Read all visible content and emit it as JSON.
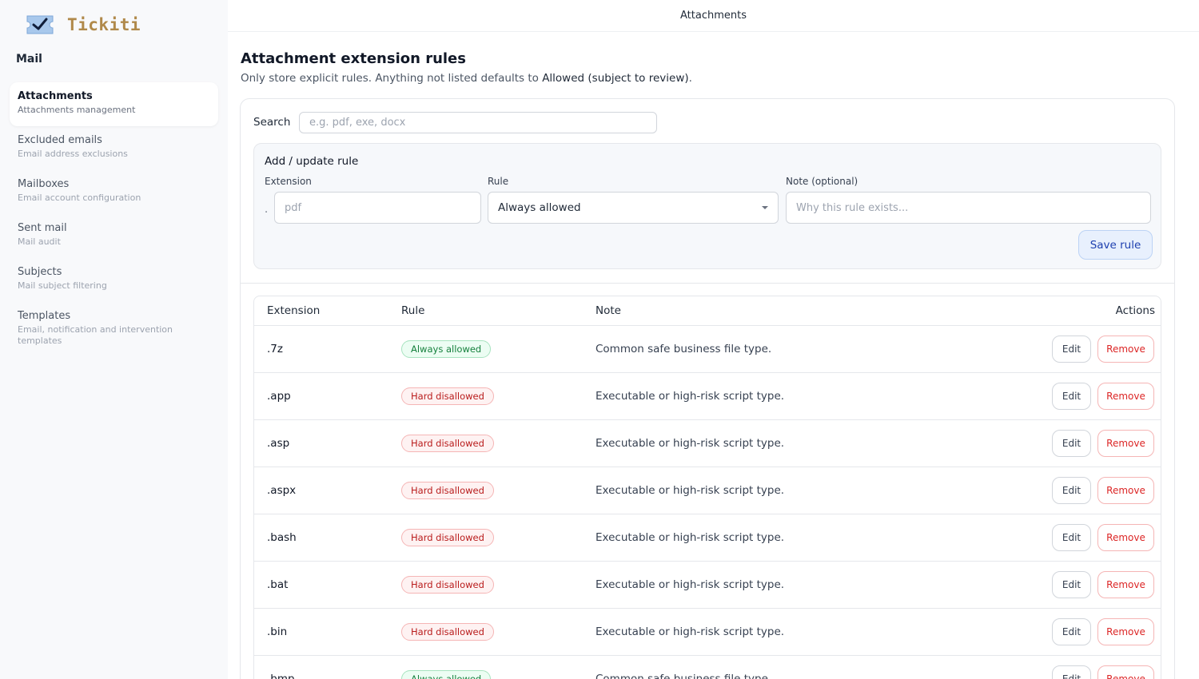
{
  "brand": {
    "name": "Tickiti",
    "logo_icon": "ticket-check-icon",
    "colors": {
      "brand_text": "#b0894a",
      "ticket_fill": "#a8c8ec",
      "check": "#0f1d3a"
    }
  },
  "sidebar": {
    "section": "Mail",
    "items": [
      {
        "label": "Attachments",
        "sub": "Attachments management",
        "active": true
      },
      {
        "label": "Excluded emails",
        "sub": "Email address exclusions"
      },
      {
        "label": "Mailboxes",
        "sub": "Email account configuration"
      },
      {
        "label": "Sent mail",
        "sub": "Mail audit"
      },
      {
        "label": "Subjects",
        "sub": "Mail subject filtering"
      },
      {
        "label": "Templates",
        "sub": "Email, notification and intervention templates"
      }
    ]
  },
  "header": {
    "title": "Attachments"
  },
  "main": {
    "title": "Attachment extension rules",
    "subtitle_prefix": "Only store explicit rules. Anything not listed defaults to ",
    "subtitle_bold": "Allowed (subject to review)",
    "subtitle_suffix": "."
  },
  "search": {
    "label": "Search",
    "placeholder": "e.g. pdf, exe, docx",
    "value": ""
  },
  "form": {
    "title": "Add / update rule",
    "extension_label": "Extension",
    "extension_prefix": ".",
    "extension_placeholder": "pdf",
    "rule_label": "Rule",
    "rule_value": "Always allowed",
    "note_label": "Note (optional)",
    "note_placeholder": "Why this rule exists...",
    "save_label": "Save rule"
  },
  "table": {
    "headers": {
      "extension": "Extension",
      "rule": "Rule",
      "note": "Note",
      "actions": "Actions"
    },
    "edit_label": "Edit",
    "remove_label": "Remove",
    "rows": [
      {
        "ext": ".7z",
        "rule": "Always allowed",
        "kind": "allowed",
        "note": "Common safe business file type."
      },
      {
        "ext": ".app",
        "rule": "Hard disallowed",
        "kind": "disallowed",
        "note": "Executable or high-risk script type."
      },
      {
        "ext": ".asp",
        "rule": "Hard disallowed",
        "kind": "disallowed",
        "note": "Executable or high-risk script type."
      },
      {
        "ext": ".aspx",
        "rule": "Hard disallowed",
        "kind": "disallowed",
        "note": "Executable or high-risk script type."
      },
      {
        "ext": ".bash",
        "rule": "Hard disallowed",
        "kind": "disallowed",
        "note": "Executable or high-risk script type."
      },
      {
        "ext": ".bat",
        "rule": "Hard disallowed",
        "kind": "disallowed",
        "note": "Executable or high-risk script type."
      },
      {
        "ext": ".bin",
        "rule": "Hard disallowed",
        "kind": "disallowed",
        "note": "Executable or high-risk script type."
      },
      {
        "ext": ".bmp",
        "rule": "Always allowed",
        "kind": "allowed",
        "note": "Common safe business file type."
      }
    ]
  }
}
